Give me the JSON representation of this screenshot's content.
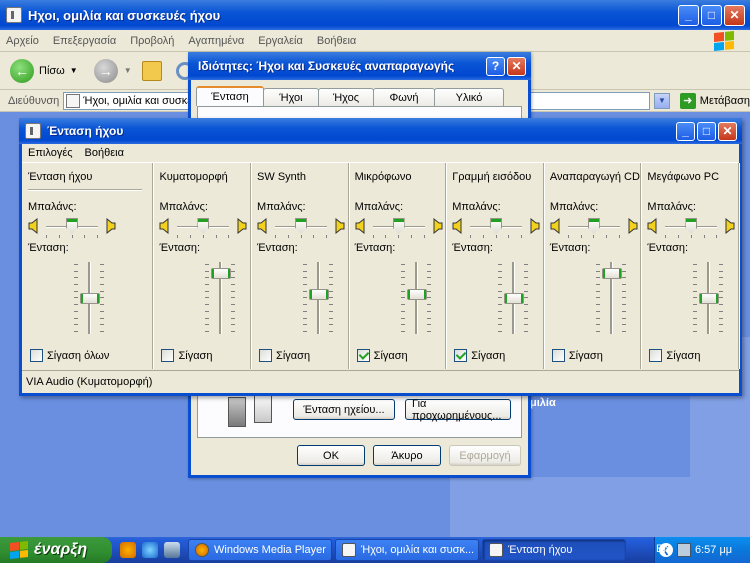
{
  "explorer": {
    "title": "Ηχοι, ομιλία και συσκευές ήχου",
    "menu": [
      "Αρχείο",
      "Επεξεργασία",
      "Προβολή",
      "Αγαπημένα",
      "Εργαλεία",
      "Βοήθεια"
    ],
    "back_label": "Πίσω",
    "address_label": "Διεύθυνση",
    "address_value": "Ήχοι, ομιλία και συσκευ",
    "go_label": "Μετάβαση",
    "body_fragment": "μιλία"
  },
  "props": {
    "title": "Ιδιότητες: Ήχοι και Συσκευές αναπαραγωγής",
    "tabs": [
      "Ένταση",
      "Ήχοι",
      "Ήχος",
      "Φωνή",
      "Υλικό"
    ],
    "volume_button": "Ένταση ηχείου...",
    "advanced_button": "Για προχωρημένους...",
    "ok": "OK",
    "cancel": "Άκυρο",
    "apply": "Εφαρμογή"
  },
  "vol": {
    "title": "Ένταση ήχου",
    "menu": [
      "Επιλογές",
      "Βοήθεια"
    ],
    "balance_label": "Μπαλάνς:",
    "volume_label": "Ένταση:",
    "channels": [
      {
        "name": "Ένταση ήχου",
        "mute_label": "Σίγαση όλων",
        "muted": false,
        "level": 0.5,
        "balance": 0.5
      },
      {
        "name": "Κυματομορφή",
        "mute_label": "Σίγαση",
        "muted": false,
        "level": 0.9,
        "balance": 0.5
      },
      {
        "name": "SW Synth",
        "mute_label": "Σίγαση",
        "muted": false,
        "level": 0.55,
        "balance": 0.5
      },
      {
        "name": "Μικρόφωνο",
        "mute_label": "Σίγαση",
        "muted": true,
        "level": 0.55,
        "balance": 0.5
      },
      {
        "name": "Γραμμή εισόδου",
        "mute_label": "Σίγαση",
        "muted": true,
        "level": 0.5,
        "balance": 0.5
      },
      {
        "name": "Αναπαραγωγή CD",
        "mute_label": "Σίγαση",
        "muted": false,
        "level": 0.9,
        "balance": 0.5
      },
      {
        "name": "Μεγάφωνο PC",
        "mute_label": "Σίγαση",
        "muted": false,
        "level": 0.5,
        "balance": 0.5
      }
    ],
    "status": "VIA Audio (Κυματομορφή)"
  },
  "taskbar": {
    "start_label": "έναρξη",
    "tasks": [
      "Windows Media Player",
      "Ήχοι, ομιλία και συσκ...",
      "Ένταση ήχου"
    ],
    "lang": "EN",
    "clock": "6:57 μμ"
  },
  "colors": {
    "titlebar": "#0a55d6",
    "window_face": "#ece9d8",
    "accent_green": "#21a121",
    "desktop": "#6a8fe0"
  }
}
